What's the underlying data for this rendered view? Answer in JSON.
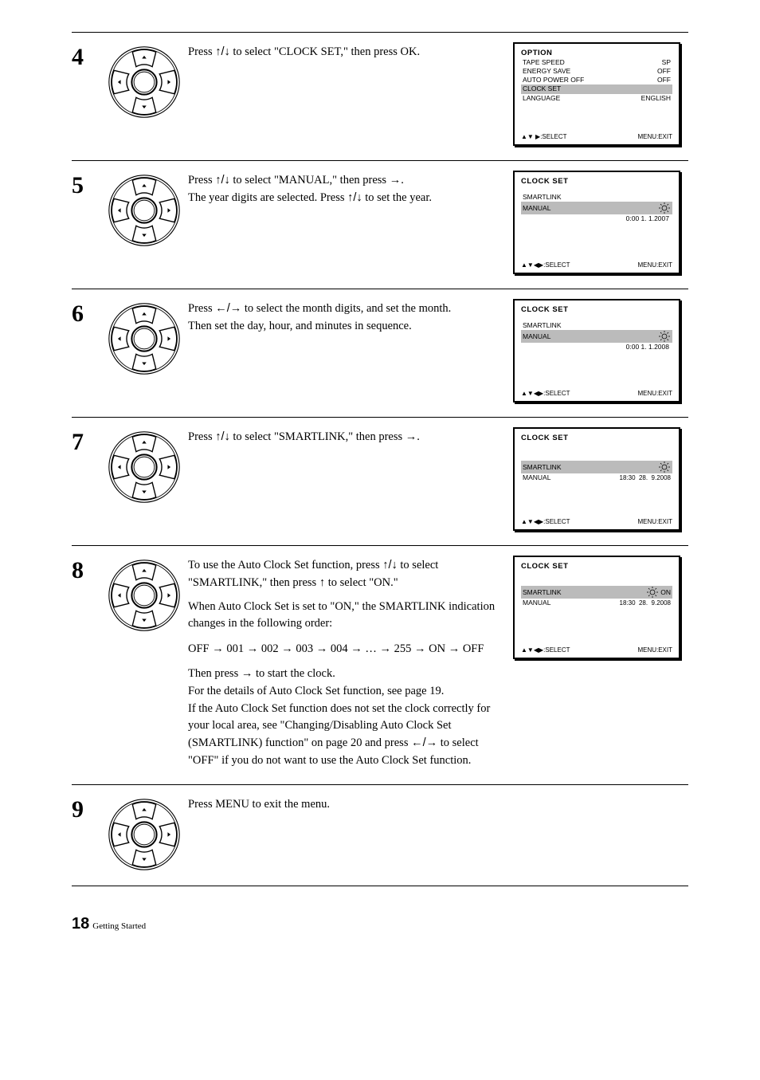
{
  "glyphs": {
    "up": "↑",
    "down": "↓",
    "left": "←",
    "right": "→",
    "updown": "↑/↓",
    "leftright": "←/→",
    "tri_up": "▲",
    "tri_down": "▼",
    "tri_left": "◀",
    "tri_right": "▶",
    "small_arrow": "→"
  },
  "steps": [
    {
      "num": "4",
      "text_parts": [
        "Press ",
        "↑/↓",
        " to select \"CLOCK SET,\" then press OK."
      ],
      "screen": {
        "title": "OPTION",
        "items": [
          {
            "label": "TAPE SPEED",
            "value": "SP"
          },
          {
            "label": "ENERGY SAVE",
            "value": "OFF"
          },
          {
            "label": "AUTO POWER OFF",
            "value": "OFF"
          },
          {
            "label": "CLOCK SET",
            "value": "",
            "hl": true
          },
          {
            "label": "LANGUAGE",
            "value": "ENGLISH"
          }
        ],
        "hint_left": [
          "▲▼",
          " ",
          "▶",
          ":",
          "SELECT"
        ],
        "hint_right": "MENU:EXIT"
      }
    },
    {
      "num": "5",
      "text_parts": [
        "Press ",
        "↑/↓",
        " to select \"MANUAL,\" then press ",
        "→",
        ".",
        "\nThe year digits are selected. Press ",
        "↑/↓",
        " to set the year."
      ],
      "screen": {
        "title": "CLOCK SET",
        "items": [
          {
            "label": "SMARTLINK",
            "value": ""
          },
          {
            "label": "MANUAL",
            "value": "",
            "hl": true,
            "time": " 0:00   1.  1.2007"
          }
        ],
        "hint_left": [
          "▲▼◀▶",
          ":",
          "SELECT"
        ],
        "hint_right": "MENU:EXIT"
      }
    },
    {
      "num": "6",
      "text_parts": [
        "Press ",
        "←/→",
        " to select the month digits, and set the month.",
        "\nThen set the day, hour, and minutes in sequence."
      ],
      "screen": {
        "title": "CLOCK SET",
        "items": [
          {
            "label": "SMARTLINK",
            "value": ""
          },
          {
            "label": "MANUAL",
            "value": "",
            "hl": true,
            "time": " 0:00   1.  1.2008"
          }
        ],
        "hint_left": [
          "▲▼◀▶",
          ":",
          "SELECT"
        ],
        "hint_right": "MENU:EXIT"
      }
    },
    {
      "num": "7",
      "text_parts": [
        "Press ",
        "↑/↓",
        " to select \"SMARTLINK,\" then press ",
        "→",
        "."
      ],
      "screen": {
        "title": "CLOCK SET",
        "items": [
          {
            "label": "SMARTLINK",
            "value": "",
            "hl": false,
            "empty_above": true
          },
          {
            "label": "SMARTLINK",
            "value": "",
            "hl": true,
            "sun_only": true
          },
          {
            "label": "MANUAL",
            "value": "",
            "time": "18:30  28.  9.2008"
          }
        ],
        "hint_left": [
          "▲▼◀▶",
          ":",
          "SELECT"
        ],
        "hint_right": "MENU:EXIT"
      }
    },
    {
      "num": "8",
      "text_parts_block1": [
        "To use the Auto Clock Set function, press ",
        "↑/↓",
        " to select \"SMARTLINK,\" then press ",
        "↑",
        " to select \"ON.\""
      ],
      "text_parts_block2": [
        "When Auto Clock Set is set to \"ON,\" the SMARTLINK indication changes in the following order:"
      ],
      "seq_items": [
        "OFF",
        "001",
        "002",
        "003",
        "004",
        "…",
        "255",
        "ON",
        "OFF"
      ],
      "text_parts_block3": [
        "Then press ",
        "→",
        " to start the clock.",
        "\nFor the details of Auto Clock Set function, see page 19.",
        "\nIf the Auto Clock Set function does not set the clock correctly for your local area, see \"Changing/Disabling Auto Clock Set (SMARTLINK) function\" on page 20 and press ",
        "←/→",
        " to select \"OFF\" if you do not want to use the Auto Clock Set function."
      ],
      "screen": {
        "title": "CLOCK SET",
        "items": [
          {
            "label": "SMARTLINK",
            "value": "ON",
            "hl": true,
            "sun_only": true
          },
          {
            "label": "MANUAL",
            "value": "",
            "time": "18:30  28.  9.2008"
          }
        ],
        "hint_left": [
          "▲▼◀▶",
          ":",
          "SELECT"
        ],
        "hint_right": "MENU:EXIT"
      }
    },
    {
      "num": "9",
      "text_parts": [
        "Press MENU to exit the menu."
      ],
      "no_screen": true
    }
  ],
  "footer": {
    "page": "18",
    "section": "Getting Started"
  }
}
